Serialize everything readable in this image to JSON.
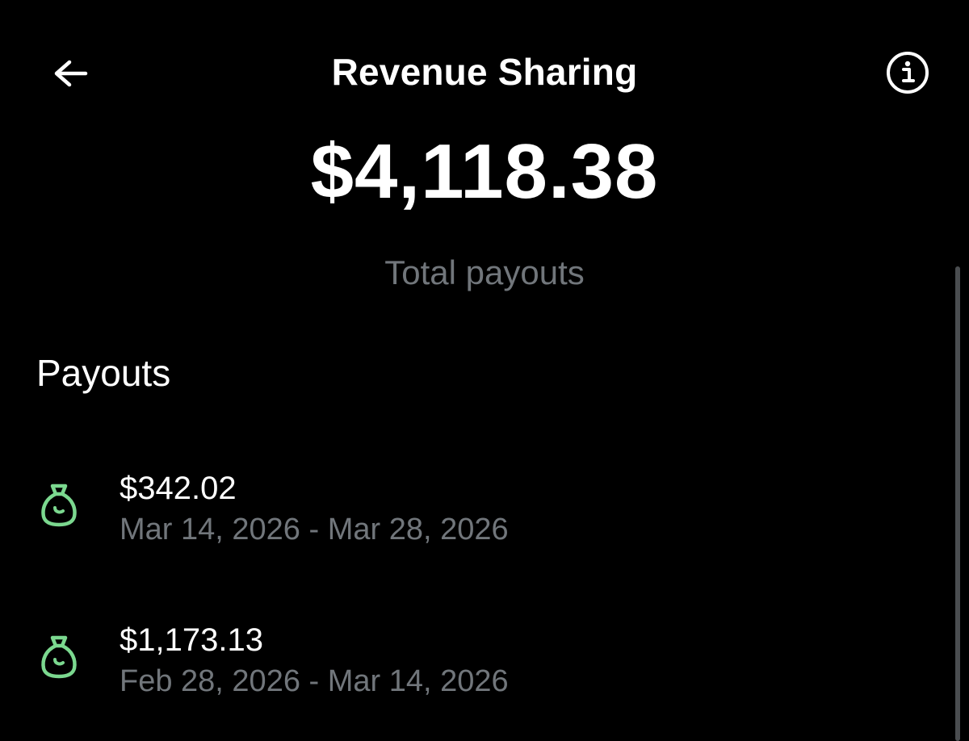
{
  "header": {
    "title": "Revenue Sharing",
    "back_icon": "arrow-left-icon",
    "info_icon": "info-circle-icon"
  },
  "summary": {
    "total_amount": "$4,118.38",
    "total_label": "Total payouts"
  },
  "payouts": {
    "section_title": "Payouts",
    "icon": "money-bag-icon",
    "icon_color": "#7bd88f",
    "items": [
      {
        "amount": "$342.02",
        "dates": "Mar 14, 2026 - Mar 28, 2026"
      },
      {
        "amount": "$1,173.13",
        "dates": "Feb 28, 2026 - Mar 14, 2026"
      }
    ]
  },
  "colors": {
    "background": "#000000",
    "primary_text": "#ffffff",
    "secondary_text": "#71767b"
  }
}
